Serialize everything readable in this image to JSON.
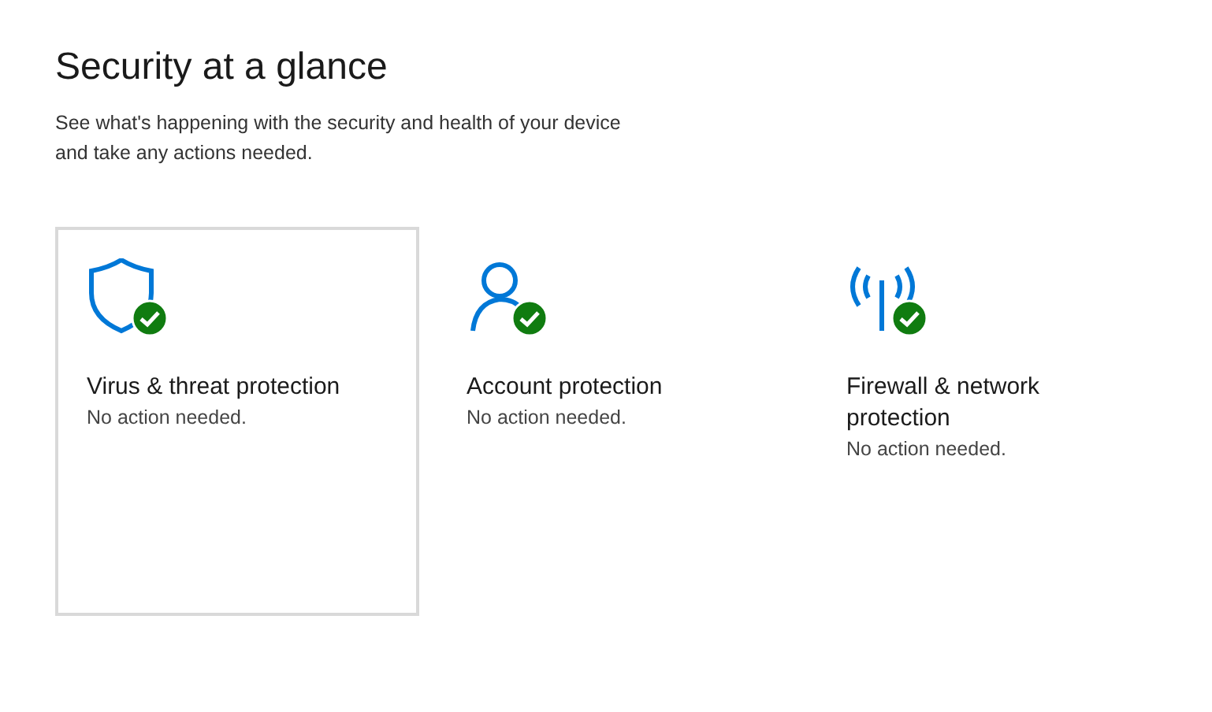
{
  "title": "Security at a glance",
  "description": "See what's happening with the security and health of your device and take any actions needed.",
  "cards": [
    {
      "kind": "shield",
      "title": "Virus & threat protection",
      "status": "No action needed.",
      "selected": true
    },
    {
      "kind": "person",
      "title": "Account protection",
      "status": "No action needed.",
      "selected": false
    },
    {
      "kind": "antenna",
      "title": "Firewall & network protection",
      "status": "No action needed.",
      "selected": false
    }
  ]
}
